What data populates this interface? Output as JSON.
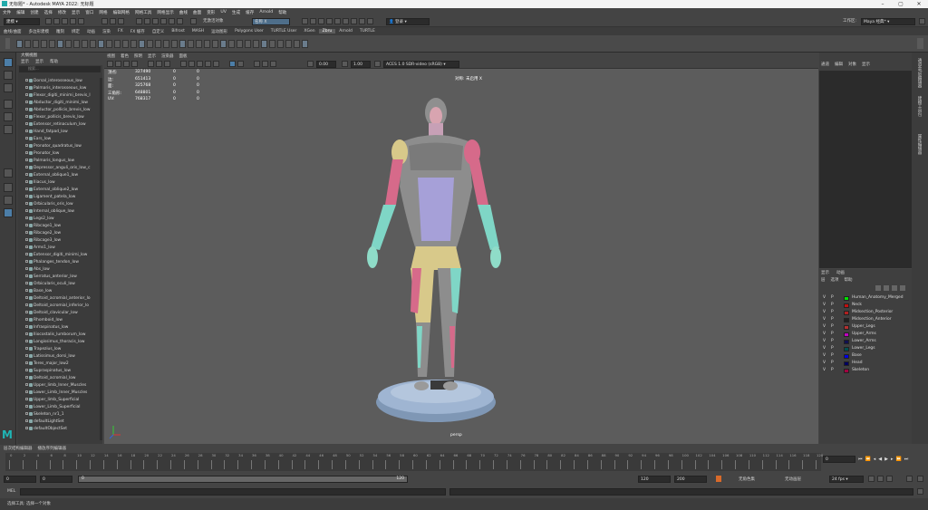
{
  "window": {
    "title": "无标题* - Autodesk MAYA 2022: 无标题",
    "controls": [
      "minimize-icon",
      "maximize-icon",
      "close-icon"
    ]
  },
  "menu": [
    "文件",
    "编辑",
    "创建",
    "选择",
    "修改",
    "显示",
    "窗口",
    "网格",
    "编辑网格",
    "网格工具",
    "网格显示",
    "曲线",
    "曲面",
    "变形",
    "UV",
    "生成",
    "缓存",
    "Arnold",
    "帮助"
  ],
  "status": {
    "mode": "建模",
    "object_field": "无激活对象",
    "search_placeholder": "名称 X",
    "login": "登录",
    "workspace_label": "工作区:",
    "workspace": "Maya 经典*"
  },
  "shelf_tabs": [
    "曲线/曲面",
    "多边形建模",
    "雕刻",
    "绑定",
    "动画",
    "渲染",
    "FX",
    "FX 缓存",
    "自定义",
    "Bifrost",
    "MASH",
    "运动图形",
    "Polygons User",
    "TURTLE User",
    "XGen",
    "Zbru",
    "Arnold",
    "TURTLE"
  ],
  "shelf_active": "Zbru",
  "outliner": {
    "title": "大纲视图",
    "menu": [
      "显示",
      "显示",
      "帮助"
    ],
    "search_placeholder": "搜索...",
    "items": [
      "Dorsal_interosseous_low",
      "Palmaris_interosseous_low",
      "Flexor_digiti_minimi_brevis_l",
      "Abductor_digiti_minimi_low",
      "Abductor_pollicis_brevis_low",
      "Flexor_pollicis_brevis_low",
      "Extensor_retinaculum_low",
      "Hand_fatpad_low",
      "Ears_low",
      "Pronator_quadratus_low",
      "Pronator_low",
      "Palmaris_longus_low",
      "Depressor_anguli_oris_low_c",
      "External_oblique1_low",
      "Iliacus_low",
      "External_oblique2_low",
      "Ligament_patela_low",
      "Orbicularis_oris_low",
      "Internal_oblique_low",
      "Legs2_low",
      "Ribcage1_low",
      "Ribcage2_low",
      "Ribcage3_low",
      "Arms1_low",
      "Extensor_digiti_minimi_low",
      "Phalanges_tendon_low",
      "Abs_low",
      "Serratus_anterior_low",
      "Orbicularis_oculi_low",
      "Base_low",
      "Deltoid_acromial_anterior_lo",
      "Deltoid_acromial_inferior_lo",
      "Deltoid_clavicular_low",
      "Rhomboid_low",
      "Infraspinatus_low",
      "Iliocostalis_lumborum_low",
      "Longissimus_thoracis_low",
      "Trapezius_low",
      "Latissimus_dorsi_low",
      "Teres_major_low2",
      "Supraspinatus_low",
      "Deltoid_acromial_low",
      "Upper_limb_Inner_Muscles",
      "Lower_Limb_Inner_Muscles",
      "Upper_limb_Superficial",
      "Lower_Limb_Superficial",
      "Skeleton_nr1_1",
      "defaultLightSet",
      "defaultObjectSet"
    ]
  },
  "viewport": {
    "menu": [
      "视图",
      "着色",
      "照明",
      "显示",
      "渲染器",
      "面板"
    ],
    "hud_labels": [
      "顶点:",
      "边:",
      "面:",
      "三角形:",
      "UV:"
    ],
    "hud_values": [
      "327490",
      "651413",
      "325768",
      "648801",
      "768317"
    ],
    "hud_zero": "0",
    "hud_title": "对称: 未启用 X",
    "camera": "persp",
    "exposure": "0.00",
    "gamma": "1.00",
    "colorspace": "ACES 1.0 SDR-video (sRGB)",
    "figure": {
      "body": "#8c8c8c",
      "muscle_red": "#d66a8a",
      "muscle_cyan": "#7fd6c6",
      "muscle_purple": "#a6a0d8",
      "muscle_yellow": "#d8c98a",
      "base": "#9fb5d2"
    }
  },
  "channel_box": {
    "menu": [
      "通道",
      "编辑",
      "对象",
      "显示"
    ]
  },
  "layers": {
    "tabs": [
      "显示",
      "动画"
    ],
    "menu": [
      "层",
      "选项",
      "帮助"
    ],
    "items": [
      {
        "v": "V",
        "p": "P",
        "color": "#00e000",
        "name": "Human_Anatomy_Merged"
      },
      {
        "v": "V",
        "p": "P",
        "color": "#c01010",
        "name": "Neck"
      },
      {
        "v": "V",
        "p": "P",
        "color": "#b02020",
        "name": "Midsection_Posterior"
      },
      {
        "v": "V",
        "p": "P",
        "color": "#202020",
        "name": "Midsection_Anterior"
      },
      {
        "v": "V",
        "p": "P",
        "color": "#b43030",
        "name": "Upper_Legs"
      },
      {
        "v": "V",
        "p": "P",
        "color": "#c000c0",
        "name": "Upper_Arms"
      },
      {
        "v": "V",
        "p": "P",
        "color": "#101050",
        "name": "Lower_Arms"
      },
      {
        "v": "V",
        "p": "P",
        "color": "#005050",
        "name": "Lower_Legs"
      },
      {
        "v": "V",
        "p": "P",
        "color": "#0000e0",
        "name": "Base"
      },
      {
        "v": "V",
        "p": "P",
        "color": "#000060",
        "name": "Head"
      },
      {
        "v": "V",
        "p": "P",
        "color": "#a00040",
        "name": "Skeleton"
      }
    ]
  },
  "side_tabs": [
    "通道盒/层编辑器",
    "建模工具包",
    "属性编辑器"
  ],
  "timeline": {
    "tabs": [
      "层次结构编辑器",
      "播放序列编辑器"
    ],
    "ticks": [
      "0",
      "2",
      "4",
      "6",
      "8",
      "10",
      "12",
      "14",
      "16",
      "18",
      "20",
      "22",
      "24",
      "26",
      "28",
      "30",
      "32",
      "34",
      "36",
      "38",
      "40",
      "42",
      "44",
      "46",
      "48",
      "50",
      "52",
      "54",
      "56",
      "58",
      "60",
      "62",
      "64",
      "66",
      "68",
      "70",
      "72",
      "74",
      "76",
      "78",
      "80",
      "82",
      "84",
      "86",
      "88",
      "90",
      "92",
      "94",
      "96",
      "98",
      "100",
      "102",
      "104",
      "106",
      "108",
      "110",
      "112",
      "114",
      "116",
      "118",
      "120"
    ],
    "current_frame": "0"
  },
  "range": {
    "start": "0",
    "inner_start": "0",
    "bar_start": "0",
    "bar_end": "120",
    "end": "120",
    "outer_end": "200",
    "char_set": "无角色集",
    "anim_layer": "无动画层",
    "fps": "24 fps"
  },
  "command_line": {
    "lang": "MEL"
  },
  "help_line": "选择工具: 选择一个对象"
}
